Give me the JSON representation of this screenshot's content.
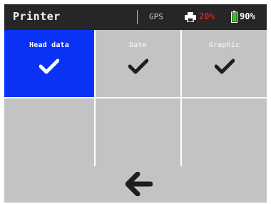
{
  "header": {
    "title": "Printer",
    "gps_label": "GPS",
    "printer_percent": "20%",
    "battery_percent": "90%",
    "printer_color": "#e01b1b",
    "battery_color": "#37c12a"
  },
  "tiles": [
    {
      "label": "Head data",
      "checked": true,
      "selected": true
    },
    {
      "label": "Date",
      "checked": true,
      "selected": false
    },
    {
      "label": "Graphic",
      "checked": true,
      "selected": false
    },
    {
      "label": "",
      "checked": false,
      "selected": false
    },
    {
      "label": "",
      "checked": false,
      "selected": false
    },
    {
      "label": "",
      "checked": false,
      "selected": false
    }
  ],
  "footer": {
    "back_icon": "arrow-left-icon"
  },
  "colors": {
    "accent": "#0a32f5",
    "tile": "#c3c3c3",
    "header_bg": "#262626"
  }
}
